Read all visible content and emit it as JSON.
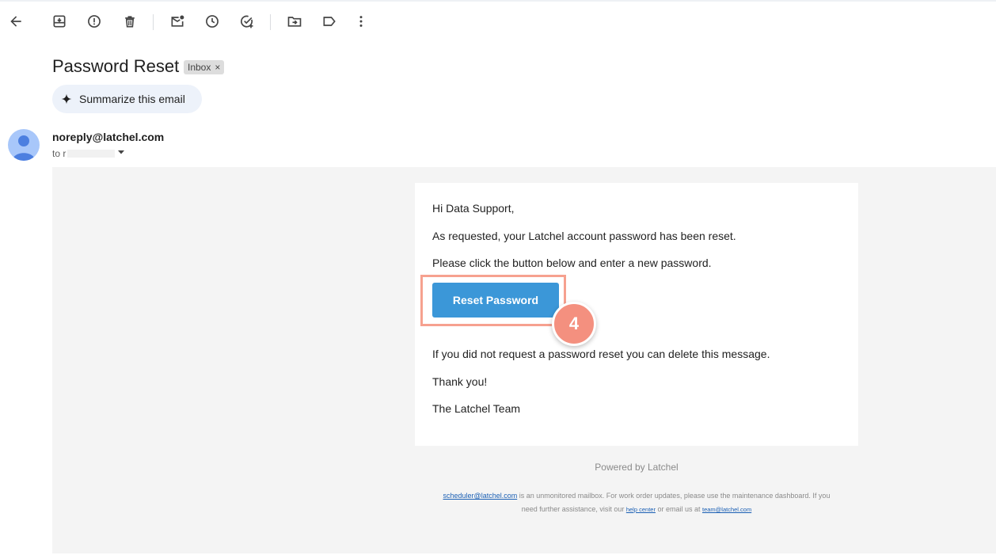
{
  "toolbar": {
    "icons": [
      "back-arrow-icon",
      "archive-icon",
      "report-spam-icon",
      "delete-icon",
      "mark-unread-icon",
      "snooze-icon",
      "add-to-tasks-icon",
      "move-to-icon",
      "label-icon",
      "more-options-icon"
    ]
  },
  "email": {
    "subject": "Password Reset",
    "label_chip": "Inbox",
    "label_remove": "×",
    "summarize_label": "Summarize this email",
    "sender": "noreply@latchel.com",
    "to_prefix": "to r"
  },
  "body": {
    "greeting": "Hi Data Support,",
    "line1": "As requested, your Latchel account password has been reset.",
    "line2": "Please click the button below and enter a new password.",
    "button_label": "Reset Password",
    "line3": "If you did not request a password reset you can delete this message.",
    "thanks": "Thank you!",
    "signature": "The Latchel Team"
  },
  "footer": {
    "powered_by": "Powered by Latchel",
    "scheduler_link": "scheduler@latchel.com",
    "text_a": " is an unmonitored mailbox. For work order updates, please use the maintenance dashboard. If you",
    "text_b": "need further assistance, visit our ",
    "help_link": "help center",
    "text_c": " or email us at ",
    "team_link": "team@latchel.com"
  },
  "annotation": {
    "step_number": "4",
    "highlight_color": "#f6a18f",
    "badge_color": "#f4907f"
  },
  "colors": {
    "button": "#3b97d8",
    "email_background": "#f4f4f4",
    "summarize_chip": "#edf2fa",
    "avatar": "#a8c7fa"
  }
}
